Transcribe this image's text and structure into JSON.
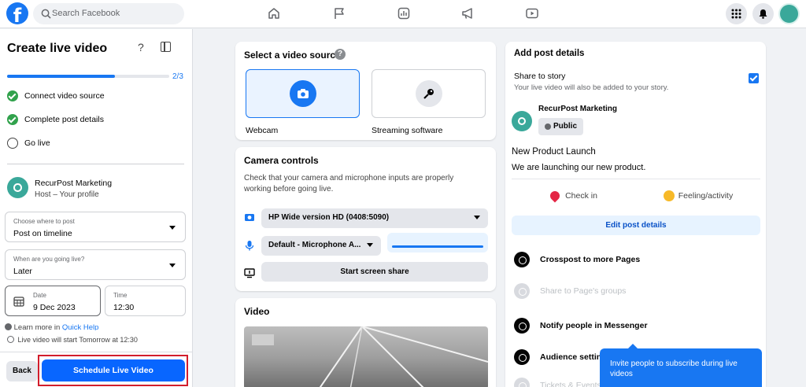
{
  "topbar": {
    "logo": "f",
    "search_placeholder": "Search Facebook",
    "nav_icons": [
      "home-icon",
      "flag-icon",
      "chart-icon",
      "megaphone-icon",
      "video-play-icon"
    ],
    "right_icons": [
      "menu-grid-icon",
      "bell-icon",
      "profile-avatar"
    ]
  },
  "left_panel": {
    "title": "Create live video",
    "help": "?",
    "progress": {
      "label": "2/3",
      "fraction": 0.667
    },
    "steps": [
      {
        "label": "Connect video source",
        "done": true
      },
      {
        "label": "Complete post details",
        "done": true
      },
      {
        "label": "Go live",
        "done": false
      }
    ],
    "host": {
      "name": "RecurPost Marketing",
      "role": "Host – Your profile"
    },
    "where": {
      "caption": "Choose where to post",
      "value": "Post on timeline"
    },
    "when": {
      "caption": "When are you going live?",
      "value": "Later"
    },
    "date": {
      "caption": "Date",
      "value": "9 Dec 2023"
    },
    "time": {
      "caption": "Time",
      "value": "12:30"
    },
    "learn_more": "Learn more in",
    "quick_help": "Quick Help",
    "will_start": "Live video will start Tomorrow at 12:30",
    "back_label": "Back",
    "schedule_label": "Schedule Live Video",
    "colors": {
      "accent": "#1877f2",
      "highlight": "#d21d2c",
      "success": "#31a24c"
    }
  },
  "video_source": {
    "title": "Select a video source",
    "options": [
      {
        "label": "Webcam",
        "icon": "camera-icon",
        "selected": true
      },
      {
        "label": "Streaming software",
        "icon": "key-icon",
        "selected": false
      }
    ]
  },
  "camera_controls": {
    "title": "Camera controls",
    "description": "Check that your camera and microphone inputs are properly working before going live.",
    "camera": "HP Wide version HD (0408:5090)",
    "microphone": "Default - Microphone A...",
    "screen_share": "Start screen share"
  },
  "video": {
    "title": "Video"
  },
  "post_details": {
    "title": "Add post details",
    "share_story": {
      "label": "Share to story",
      "sub": "Your live video will also be added to your story.",
      "checked": true
    },
    "page_name": "RecurPost Marketing",
    "privacy": "Public",
    "post_title": "New Product Launch",
    "post_text": "We are launching our new product.",
    "actions": [
      {
        "label": "Check in",
        "icon": "location-pin-icon"
      },
      {
        "label": "Feeling/activity",
        "icon": "smiley-icon"
      }
    ],
    "edit_label": "Edit post details",
    "options": [
      {
        "label": "Crosspost to more Pages",
        "icon": "crosspost-icon",
        "enabled": true
      },
      {
        "label": "Share to Page's groups",
        "icon": "groups-icon",
        "enabled": false
      },
      {
        "label": "Notify people in Messenger",
        "icon": "messenger-icon",
        "enabled": true
      },
      {
        "label": "Audience settings",
        "icon": "globe-icon",
        "enabled": true
      },
      {
        "label": "Tickets & Events",
        "icon": "ticket-icon",
        "enabled": false
      }
    ]
  },
  "tooltip": {
    "text": "Invite people to subscribe during live videos"
  }
}
